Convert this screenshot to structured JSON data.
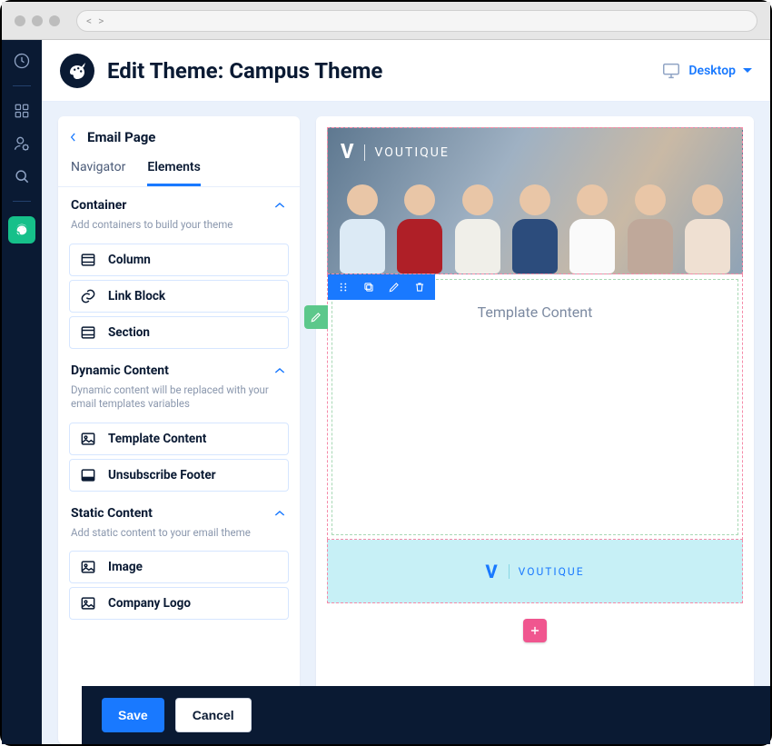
{
  "header": {
    "title": "Edit Theme: Campus Theme",
    "viewport_label": "Desktop"
  },
  "panel": {
    "back_label": "Email Page",
    "tabs": {
      "navigator": "Navigator",
      "elements": "Elements",
      "active": "elements"
    },
    "sections": [
      {
        "title": "Container",
        "desc": "Add containers to build your theme",
        "items": [
          {
            "icon": "column",
            "label": "Column"
          },
          {
            "icon": "link",
            "label": "Link Block"
          },
          {
            "icon": "section",
            "label": "Section"
          }
        ]
      },
      {
        "title": "Dynamic Content",
        "desc": "Dynamic content will be replaced with your email templates variables",
        "items": [
          {
            "icon": "image",
            "label": "Template Content"
          },
          {
            "icon": "footer",
            "label": "Unsubscribe Footer"
          }
        ]
      },
      {
        "title": "Static Content",
        "desc": "Add static content to your email theme",
        "items": [
          {
            "icon": "image",
            "label": "Image"
          },
          {
            "icon": "image",
            "label": "Company Logo"
          }
        ]
      }
    ]
  },
  "canvas": {
    "brand": "VOUTIQUE",
    "template_placeholder": "Template Content",
    "footer_brand": "VOUTIQUE"
  },
  "footer": {
    "save": "Save",
    "cancel": "Cancel"
  }
}
